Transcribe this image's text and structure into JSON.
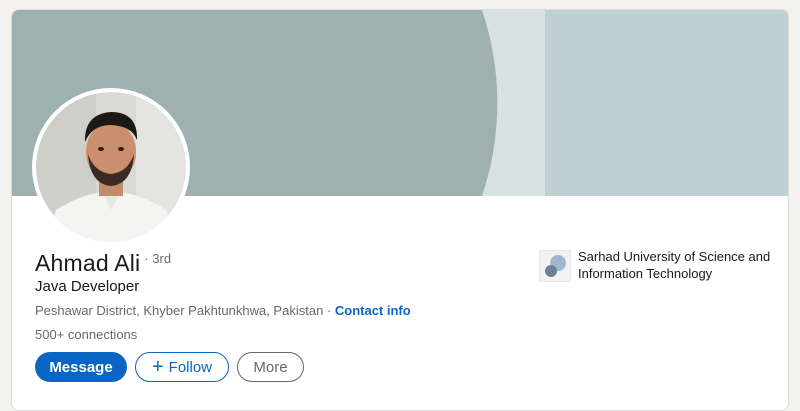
{
  "profile": {
    "name": "Ahmad Ali",
    "degree": "· 3rd",
    "headline": "Java Developer",
    "location": "Peshawar District, Khyber Pakhtunkhwa, Pakistan",
    "separator": " · ",
    "contact_info_label": "Contact info",
    "connections": "500+ connections"
  },
  "actions": {
    "message_label": "Message",
    "follow_plus": "+",
    "follow_label": "Follow",
    "more_label": "More"
  },
  "education": {
    "school_name": "Sarhad University of Science and Information Technology"
  },
  "colors": {
    "brand_blue": "#0a66c2",
    "banner_light": "#bfd0d5",
    "banner_dark": "#9fb0b3"
  },
  "icons": {
    "avatar": "profile-photo",
    "school_logo": "school-logo-icon",
    "follow": "plus-icon"
  }
}
